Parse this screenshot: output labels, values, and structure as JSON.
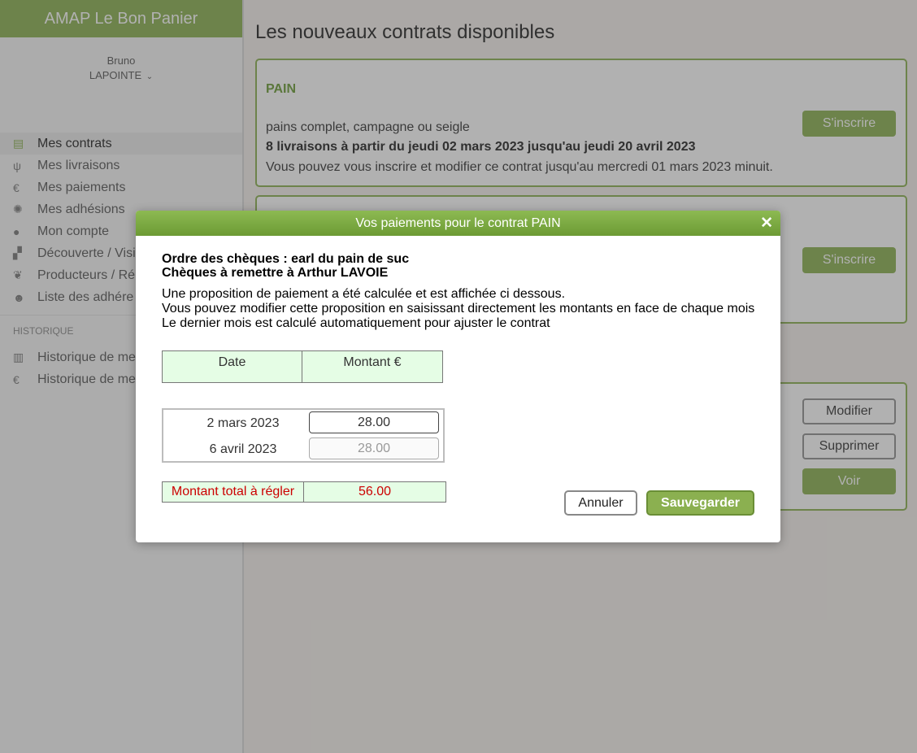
{
  "app": {
    "title": "AMAP Le Bon Panier"
  },
  "user": {
    "first_name": "Bruno",
    "last_name": "LAPOINTE",
    "dropdown_icon": "chevron-down-icon"
  },
  "sidebar": {
    "items": [
      {
        "label": "Mes contrats",
        "icon": "document-icon",
        "glyph": "▤"
      },
      {
        "label": "Mes livraisons",
        "icon": "utensils-icon",
        "glyph": "ψ"
      },
      {
        "label": "Mes paiements",
        "icon": "euro-icon",
        "glyph": "€"
      },
      {
        "label": "Mes adhésions",
        "icon": "gear-icon",
        "glyph": "✺"
      },
      {
        "label": "Mon compte",
        "icon": "user-icon",
        "glyph": "●"
      },
      {
        "label": "Découverte / Visi",
        "icon": "checkerboard-icon",
        "glyph": "▞"
      },
      {
        "label": "Producteurs / Ré",
        "icon": "leaf-icon",
        "glyph": "❦"
      },
      {
        "label": "Liste des adhére",
        "icon": "users-icon",
        "glyph": "☻"
      }
    ],
    "section_history": "HISTORIQUE",
    "history_items": [
      {
        "label": "Historique de me",
        "icon": "book-icon",
        "glyph": "▥"
      },
      {
        "label": "Historique de me",
        "icon": "euro-icon",
        "glyph": "€"
      }
    ]
  },
  "main": {
    "title": "Les nouveaux contrats disponibles",
    "cards": [
      {
        "name": "PAIN",
        "description": "pains complet, campagne ou seigle",
        "schedule": "8 livraisons à partir du jeudi 02 mars 2023 jusqu'au jeudi 20 avril 2023",
        "note": "Vous pouvez vous inscrire et modifier ce contrat jusqu'au mercredi 01 mars 2023 minuit.",
        "button": "S'inscrire"
      },
      {
        "button": "S'inscrire"
      }
    ],
    "my_contract_buttons": {
      "modify": "Modifier",
      "delete": "Supprimer",
      "view": "Voir"
    }
  },
  "modal": {
    "title": "Vos paiements pour le contrat PAIN",
    "close_glyph": "✕",
    "order_line": "Ordre des chèques : earl du pain de suc",
    "recipient_line": "Chèques à remettre à Arthur LAVOIE",
    "explain_1": "Une proposition de paiement a été calculée et est affichée ci dessous.",
    "explain_2": "Vous pouvez modifier cette proposition en saisissant directement les montants en face de chaque mois",
    "explain_3": "Le dernier mois est calculé automatiquement pour ajuster le contrat",
    "headers": {
      "date": "Date",
      "amount": "Montant €"
    },
    "rows": [
      {
        "date": "2 mars 2023",
        "amount": "28.00"
      },
      {
        "date": "6 avril 2023",
        "amount": "28.00"
      }
    ],
    "total_label": "Montant total à régler",
    "total_value": "56.00",
    "cancel_label": "Annuler",
    "save_label": "Sauvegarder"
  }
}
